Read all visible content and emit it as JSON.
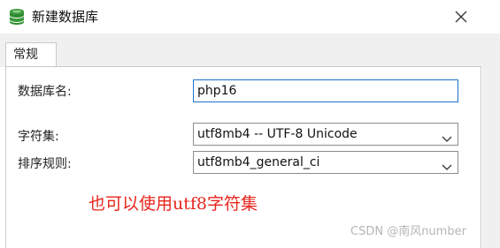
{
  "window": {
    "title": "新建数据库",
    "icon": "database-icon",
    "close_icon": "close-icon"
  },
  "tabs": [
    {
      "label": "常规",
      "active": true
    }
  ],
  "form": {
    "db_name_label": "数据库名:",
    "db_name_value": "php16",
    "charset_label": "字符集:",
    "charset_value": "utf8mb4 -- UTF-8 Unicode",
    "collation_label": "排序规则:",
    "collation_value": "utf8mb4_general_ci"
  },
  "annotation": {
    "text": "也可以使用utf8字符集",
    "color": "#e8241c"
  },
  "watermark": {
    "text": "CSDN @南风number"
  },
  "colors": {
    "accent": "#1a73c9",
    "icon_green": "#3a9a3a"
  }
}
